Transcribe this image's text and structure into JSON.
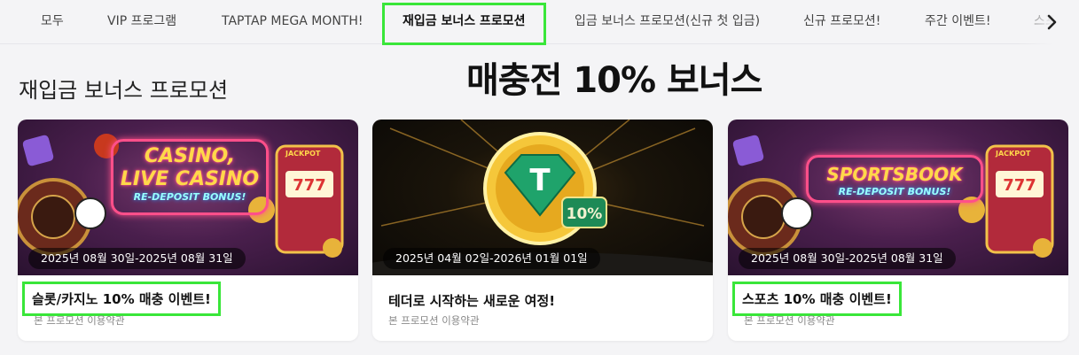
{
  "tabs": {
    "items": [
      {
        "label": "모두"
      },
      {
        "label": "VIP 프로그램"
      },
      {
        "label": "TAPTAP MEGA MONTH!"
      },
      {
        "label": "재입금 보너스 프로모션"
      },
      {
        "label": "입금 보너스 프로모션(신규 첫 입금)"
      },
      {
        "label": "신규 프로모션!"
      },
      {
        "label": "주간 이벤트!"
      },
      {
        "label": "스포"
      }
    ],
    "active_index": 3
  },
  "section": {
    "title": "재입금 보너스 프로모션"
  },
  "overlay_heading": "매충전 10% 보너스",
  "cards": [
    {
      "date_range": "2025년 08월 30일-2025년 08월 31일",
      "title": "슬롯/카지노 10% 매충 이벤트!",
      "subtitle": "본 프로모션 이용약관",
      "banner": {
        "line1a": "CASINO,",
        "line1b": "LIVE CASINO",
        "line2": "RE-DEPOSIT BONUS!",
        "sign": "JACKPOT"
      }
    },
    {
      "date_range": "2025년 04월 02일-2026년 01월 01일",
      "title": "테더로 시작하는 새로운 여정!",
      "subtitle": "본 프로모션 이용약관",
      "banner": {
        "badge": "10%",
        "glyph": "T"
      }
    },
    {
      "date_range": "2025년 08월 30일-2025년 08월 31일",
      "title": "스포츠 10% 매충 이벤트!",
      "subtitle": "본 프로모션 이용약관",
      "banner": {
        "line1": "SPORTSBOOK",
        "line2": "RE-DEPOSIT BONUS!",
        "sign": "JACKPOT"
      }
    }
  ],
  "colors": {
    "highlight": "#39e639",
    "background": "#f4f4f6",
    "card": "#ffffff"
  }
}
